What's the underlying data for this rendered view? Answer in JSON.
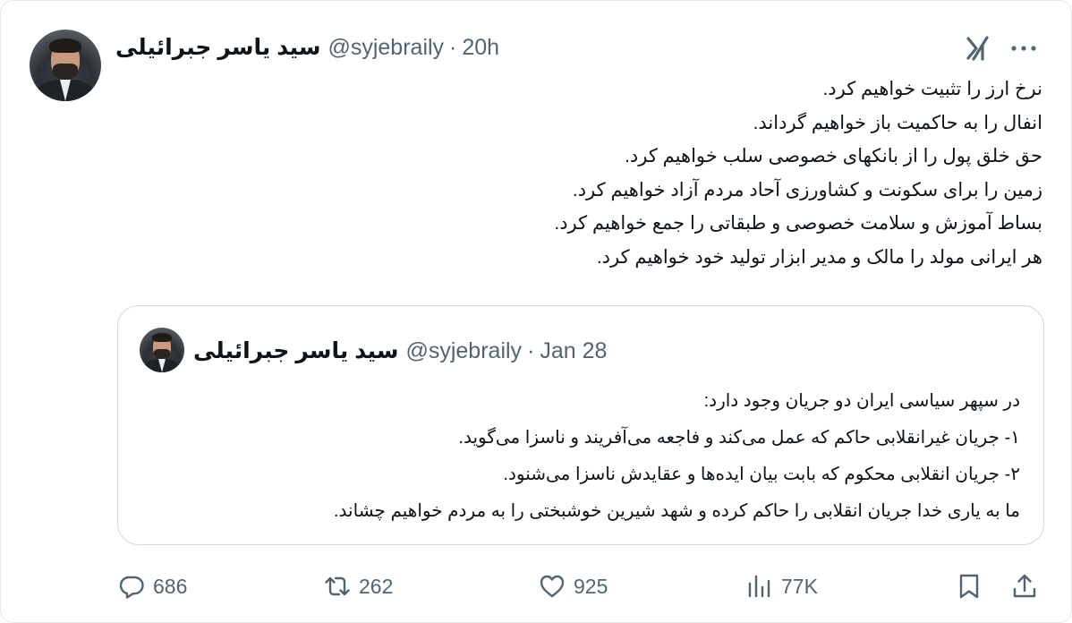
{
  "tweet": {
    "author": {
      "display_name": "سید یاسر جبرائیلی",
      "handle": "@syjebraily",
      "time": "20h"
    },
    "separator": "·",
    "lines": [
      "نرخ ارز را تثبیت خواهیم کرد.",
      "انفال را به حاکمیت باز خواهیم گرداند.",
      "حق خلق پول را از بانکهای خصوصی سلب خواهیم کرد.",
      "زمین را برای سکونت و کشاورزی آحاد مردم آزاد خواهیم کرد.",
      "بساط آموزش و سلامت خصوصی و طبقاتی را جمع خواهیم کرد.",
      "هر ایرانی مولد را مالک و مدیر ابزار تولید خود خواهیم کرد."
    ]
  },
  "quote": {
    "author": {
      "display_name": "سید یاسر جبرائیلی",
      "handle": "@syjebraily",
      "time": "Jan 28"
    },
    "separator": "·",
    "lines": [
      "در سپهر سیاسی ایران دو جریان وجود دارد:",
      "۱- جریان غیرانقلابی حاکم که عمل می‌کند و فاجعه می‌آفریند و ناسزا می‌گوید.",
      "۲- جریان انقلابی محکوم که بابت بیان ایده‌ها و عقایدش ناسزا می‌شنود.",
      "ما به یاری خدا جریان انقلابی را حاکم کرده و شهد شیرین خوشبختی را به مردم خواهیم چشاند."
    ]
  },
  "actions": {
    "reply": {
      "icon": "reply-icon",
      "count": "686"
    },
    "retweet": {
      "icon": "retweet-icon",
      "count": "262"
    },
    "like": {
      "icon": "heart-icon",
      "count": "925"
    },
    "views": {
      "icon": "views-icon",
      "count": "77K"
    },
    "bookmark": {
      "icon": "bookmark-icon"
    },
    "share": {
      "icon": "share-icon"
    }
  },
  "icons": {
    "grok": "grok-icon",
    "more": "more-icon"
  },
  "colors": {
    "text": "#0f1419",
    "secondary": "#536471",
    "border": "#cfd9de"
  }
}
